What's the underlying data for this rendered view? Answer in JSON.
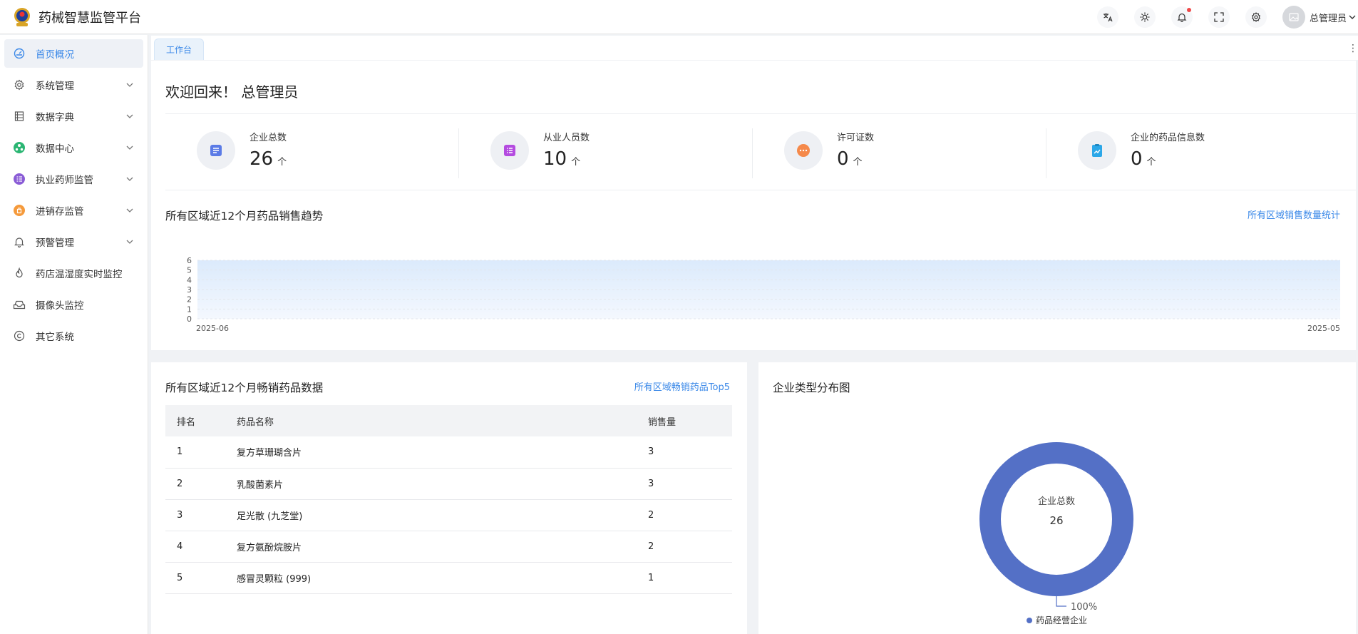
{
  "app": {
    "title": "药械智慧监管平台"
  },
  "header": {
    "icons": [
      "translate-icon",
      "theme-icon",
      "bell-icon",
      "fullscreen-icon",
      "gear-icon"
    ],
    "user_name": "总管理员"
  },
  "sidebar": {
    "items": [
      {
        "label": "首页概况",
        "icon": "dashboard-icon",
        "active": true,
        "expandable": false
      },
      {
        "label": "系统管理",
        "icon": "gear-icon",
        "active": false,
        "expandable": true
      },
      {
        "label": "数据字典",
        "icon": "dictionary-icon",
        "active": false,
        "expandable": true
      },
      {
        "label": "数据中心",
        "icon": "data-center-icon",
        "active": false,
        "expandable": true
      },
      {
        "label": "执业药师监管",
        "icon": "pharmacist-icon",
        "active": false,
        "expandable": true
      },
      {
        "label": "进销存监管",
        "icon": "inventory-icon",
        "active": false,
        "expandable": true
      },
      {
        "label": "预警管理",
        "icon": "bell-icon",
        "active": false,
        "expandable": true
      },
      {
        "label": "药店温湿度实时监控",
        "icon": "flame-icon",
        "active": false,
        "expandable": false
      },
      {
        "label": "摄像头监控",
        "icon": "camera-icon",
        "active": false,
        "expandable": false
      },
      {
        "label": "其它系统",
        "icon": "copyright-icon",
        "active": false,
        "expandable": false
      }
    ]
  },
  "tabs": [
    {
      "label": "工作台"
    }
  ],
  "welcome": "欢迎回来！ 总管理员",
  "stats": [
    {
      "label": "企业总数",
      "value": "26",
      "unit": "个",
      "color": "#5b7be6"
    },
    {
      "label": "从业人员数",
      "value": "10",
      "unit": "个",
      "color": "#b44be0"
    },
    {
      "label": "许可证数",
      "value": "0",
      "unit": "个",
      "color": "#f5894a"
    },
    {
      "label": "企业的药品信息数",
      "value": "0",
      "unit": "个",
      "color": "#2ba7e8"
    }
  ],
  "trend": {
    "title": "所有区域近12个月药品销售趋势",
    "link": "所有区域销售数量统计",
    "y_ticks": [
      "0",
      "1",
      "2",
      "3",
      "4",
      "5",
      "6"
    ],
    "x_start": "2025-06",
    "x_end": "2025-05"
  },
  "chart_data": [
    {
      "type": "area",
      "title": "所有区域近12个月药品销售趋势",
      "x_labels_shown": [
        "2025-06",
        "2025-05"
      ],
      "ylim": [
        0,
        6
      ],
      "y_ticks": [
        0,
        1,
        2,
        3,
        4,
        5,
        6
      ],
      "values_approx": [
        6,
        6,
        6,
        6,
        6,
        6,
        6,
        6,
        6,
        6,
        6,
        6
      ],
      "grid": true
    },
    {
      "type": "pie",
      "title": "企业类型分布图",
      "center_label": "企业总数",
      "center_value": "26",
      "slices": [
        {
          "name": "药品经营企业",
          "value": 26,
          "percent": "100%"
        }
      ],
      "legend": "bottom-center"
    }
  ],
  "top_drugs": {
    "title": "所有区域近12个月畅销药品数据",
    "link": "所有区域畅销药品Top5",
    "columns": [
      "排名",
      "药品名称",
      "销售量"
    ],
    "rows": [
      [
        "1",
        "复方草珊瑚含片",
        "3"
      ],
      [
        "2",
        "乳酸菌素片",
        "3"
      ],
      [
        "3",
        "足光散 (九芝堂)",
        "2"
      ],
      [
        "4",
        "复方氨酚烷胺片",
        "2"
      ],
      [
        "5",
        "感冒灵颗粒 (999)",
        "1"
      ]
    ]
  },
  "distribution": {
    "title": "企业类型分布图",
    "center_label": "企业总数",
    "center_value": "26",
    "percent": "100%",
    "legend_label": "药品经营企业",
    "color": "#5470c6"
  }
}
